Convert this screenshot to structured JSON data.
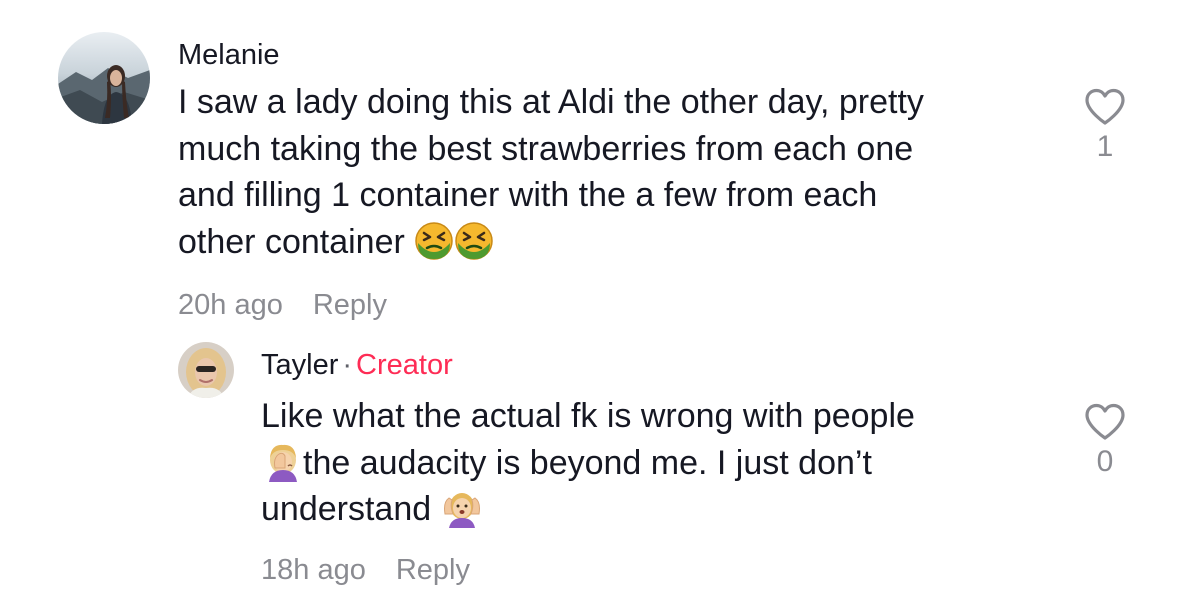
{
  "comments": [
    {
      "username": "Melanie",
      "text_lines": [
        "I saw a lady doing this at Aldi the other day, pretty",
        "much taking the best strawberries from each one",
        "and filling 1 container with the a few from each",
        "other container"
      ],
      "emojis": [
        "nauseated-face-emoji",
        "nauseated-face-emoji"
      ],
      "time": "20h ago",
      "reply_label": "Reply",
      "like_count": "1"
    },
    {
      "username": "Tayler",
      "separator": "·",
      "badge": "Creator",
      "text_lines": [
        "Like what the actual fk is wrong with people",
        "the audacity is beyond me. I just don’t",
        "understand"
      ],
      "emojis": [
        "facepalm-emoji",
        "screaming-face-emoji"
      ],
      "time": "18h ago",
      "reply_label": "Reply",
      "like_count": "0"
    }
  ],
  "colors": {
    "text": "#161823",
    "secondary": "#8a8b91",
    "creator_badge": "#fe2c55"
  }
}
